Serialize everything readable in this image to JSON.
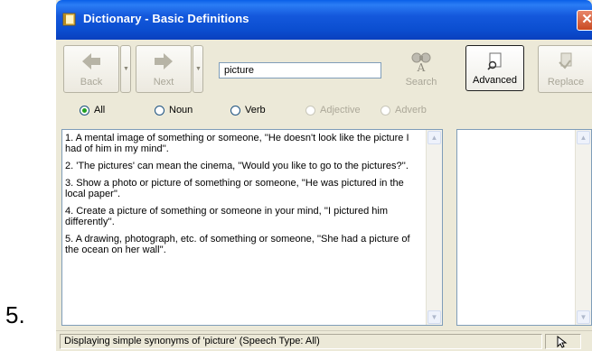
{
  "outer_label": "5.",
  "window": {
    "title": "Dictionary - Basic Definitions",
    "close_glyph": "✕"
  },
  "toolbar": {
    "back_label": "Back",
    "next_label": "Next",
    "search_value": "picture",
    "search_label": "Search",
    "advanced_label": "Advanced",
    "replace_label": "Replace"
  },
  "filters": {
    "selected": "All",
    "options": [
      {
        "label": "All",
        "enabled": true,
        "checked": true
      },
      {
        "label": "Noun",
        "enabled": true,
        "checked": false
      },
      {
        "label": "Verb",
        "enabled": true,
        "checked": false
      },
      {
        "label": "Adjective",
        "enabled": false,
        "checked": false
      },
      {
        "label": "Adverb",
        "enabled": false,
        "checked": false
      }
    ]
  },
  "definitions": [
    "1. A mental image of something or someone, ''He doesn't look like the picture I had of him in my mind''.",
    "2. 'The pictures' can mean the cinema, ''Would you like to go to the pictures?''.",
    "3. Show a photo or picture of something or someone, ''He was pictured in the local paper''.",
    "4. Create a picture of something or someone in your mind, ''I pictured him differently''.",
    "5. A drawing, photograph, etc. of something or someone, ''She had a picture of the ocean on her wall''."
  ],
  "status": {
    "text": "Displaying simple synonyms of 'picture' (Speech Type: All)"
  },
  "colors": {
    "title_bar": "#0a4ed0",
    "window_bg": "#ece9d8",
    "radio_check": "#21a121"
  }
}
